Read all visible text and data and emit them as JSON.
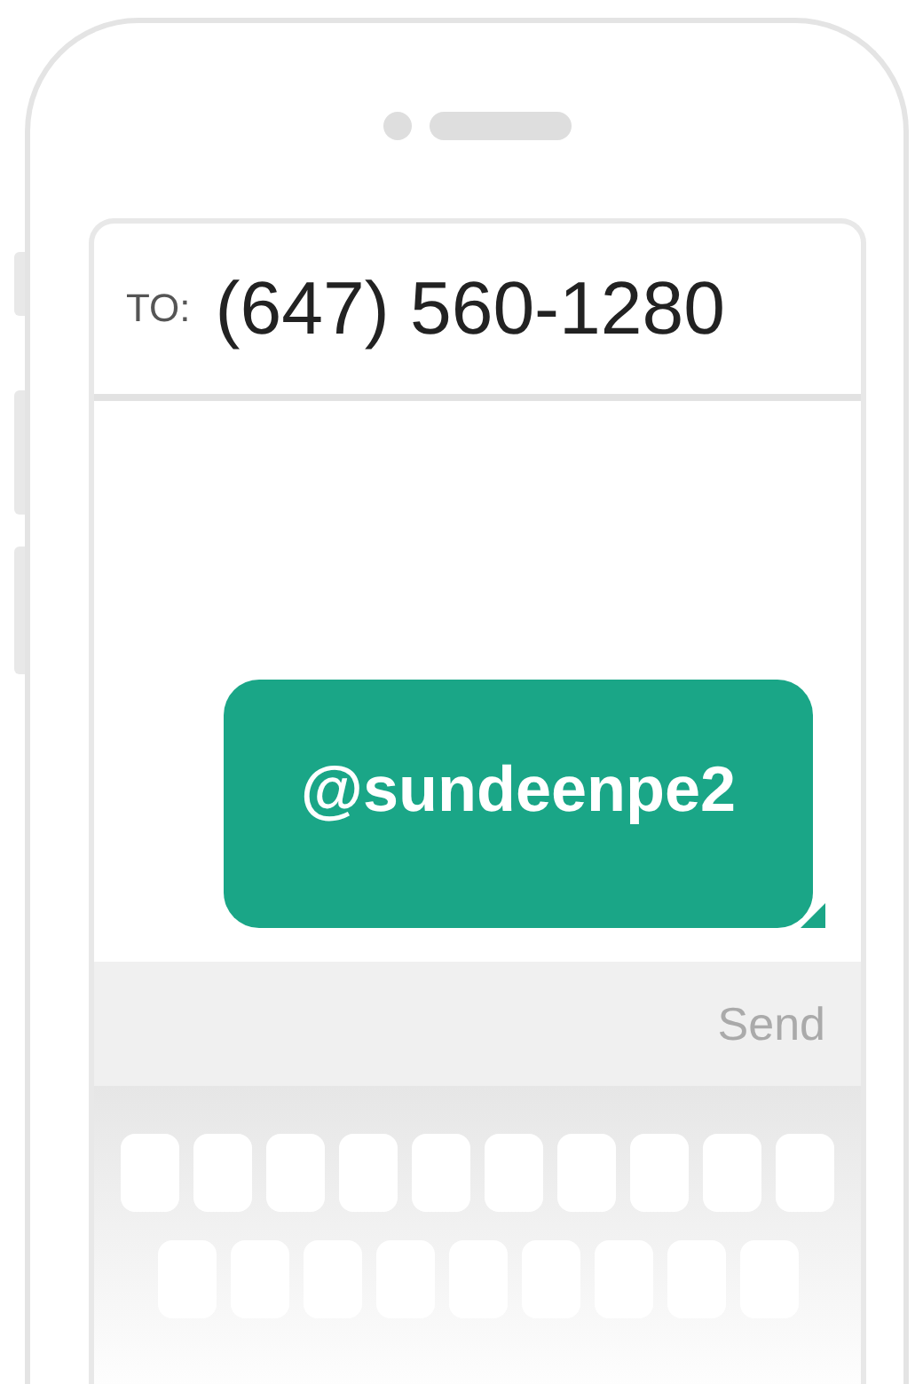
{
  "recipient": {
    "label": "TO:",
    "number": "(647) 560-1280"
  },
  "messages": [
    {
      "kind": "sent",
      "text": "@sundeenpe2"
    }
  ],
  "send_button": {
    "label": "Send",
    "disabled": true
  }
}
